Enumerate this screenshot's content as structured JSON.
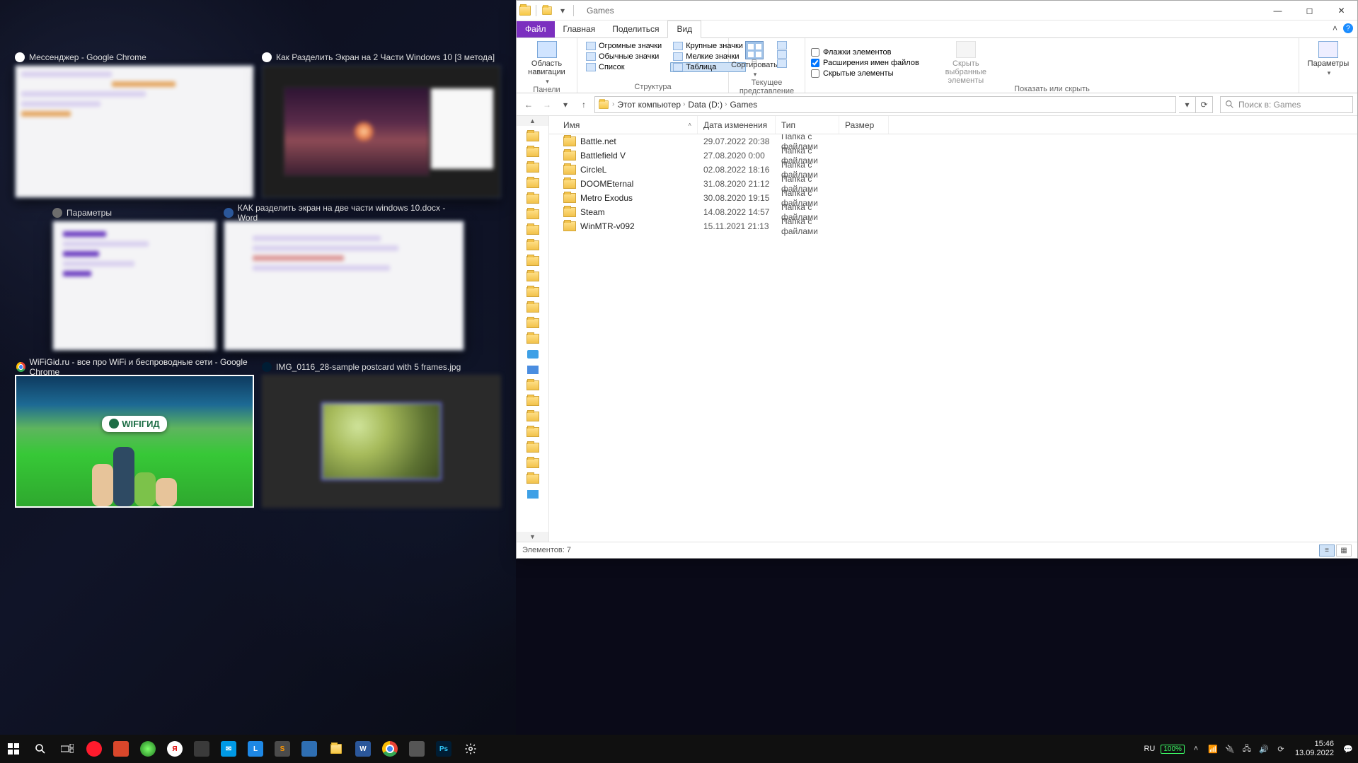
{
  "taskview": {
    "thumb_chrome1": "Мессенджер - Google Chrome",
    "thumb_chrome2": "Как Разделить Экран на 2 Части Windows 10 [3 метода]",
    "thumb_settings": "Параметры",
    "thumb_word": "КАК разделить экран на две части windows 10.docx - Word",
    "thumb_wifi": "WiFiGid.ru - все про WiFi и беспроводные сети - Google Chrome",
    "thumb_ps": "IMG_0116_28-sample postcard with 5 frames.jpg",
    "wifi_logo": "WIFIГИД"
  },
  "explorer": {
    "title": "Games",
    "tabs": {
      "file": "Файл",
      "home": "Главная",
      "share": "Поделиться",
      "view": "Вид"
    },
    "ribbon": {
      "nav_pane": "Область навигации",
      "huge": "Огромные значки",
      "large": "Крупные значки",
      "medium": "Обычные значки",
      "small": "Мелкие значки",
      "list": "Список",
      "details": "Таблица",
      "grp_layout": "Структура",
      "sort": "Сортировать",
      "grp_current": "Текущее представление",
      "chk_boxes": "Флажки элементов",
      "chk_ext": "Расширения имен файлов",
      "chk_hidden": "Скрытые элементы",
      "hide_sel": "Скрыть выбранные элементы",
      "grp_show": "Показать или скрыть",
      "options": "Параметры"
    },
    "breadcrumb": {
      "pc": "Этот компьютер",
      "drive": "Data (D:)",
      "folder": "Games"
    },
    "search_placeholder": "Поиск в: Games",
    "columns": {
      "name": "Имя",
      "date": "Дата изменения",
      "type": "Тип",
      "size": "Размер"
    },
    "rows": [
      {
        "name": "Battle.net",
        "date": "29.07.2022 20:38",
        "type": "Папка с файлами"
      },
      {
        "name": "Battlefield V",
        "date": "27.08.2020 0:00",
        "type": "Папка с файлами"
      },
      {
        "name": "CircleL",
        "date": "02.08.2022 18:16",
        "type": "Папка с файлами"
      },
      {
        "name": "DOOMEternal",
        "date": "31.08.2020 21:12",
        "type": "Папка с файлами"
      },
      {
        "name": "Metro Exodus",
        "date": "30.08.2020 19:15",
        "type": "Папка с файлами"
      },
      {
        "name": "Steam",
        "date": "14.08.2022 14:57",
        "type": "Папка с файлами"
      },
      {
        "name": "WinMTR-v092",
        "date": "15.11.2021 21:13",
        "type": "Папка с файлами"
      }
    ],
    "status": "Элементов: 7"
  },
  "taskbar": {
    "lang": "RU",
    "battery": "100%",
    "time": "15:46",
    "date": "13.09.2022"
  }
}
